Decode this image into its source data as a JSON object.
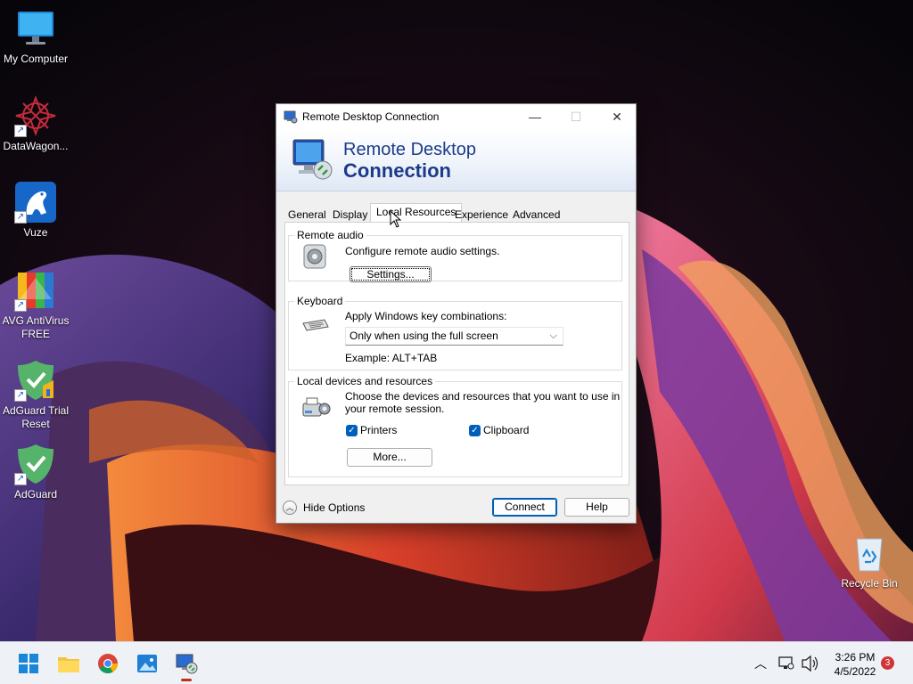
{
  "desktop": {
    "icons": [
      {
        "label": "My Computer",
        "icon": "monitor-icon"
      },
      {
        "label": "DataWagon...",
        "icon": "datawagon-icon"
      },
      {
        "label": "Vuze",
        "icon": "vuze-frog-icon"
      },
      {
        "label": "AVG AntiVirus FREE",
        "icon": "avg-icon"
      },
      {
        "label": "AdGuard Trial Reset",
        "icon": "adguard-trial-icon"
      },
      {
        "label": "AdGuard",
        "icon": "adguard-shield-icon"
      },
      {
        "label": "Recycle Bin",
        "icon": "recycle-bin-icon"
      }
    ]
  },
  "dialog": {
    "title": "Remote Desktop Connection",
    "banner": {
      "line1": "Remote Desktop",
      "line2": "Connection"
    },
    "tabs": [
      "General",
      "Display",
      "Local Resources",
      "Experience",
      "Advanced"
    ],
    "active_tab": "Local Resources",
    "remote_audio": {
      "label": "Remote audio",
      "description": "Configure remote audio settings.",
      "button": "Settings..."
    },
    "keyboard": {
      "label": "Keyboard",
      "description": "Apply Windows key combinations:",
      "selected": "Only when using the full screen",
      "example": "Example: ALT+TAB"
    },
    "local_devices": {
      "label": "Local devices and resources",
      "description_line1": "Choose the devices and resources that you want to use in",
      "description_line2": "your remote session.",
      "checkboxes": [
        {
          "label": "Printers",
          "checked": true
        },
        {
          "label": "Clipboard",
          "checked": true
        }
      ],
      "more_button": "More..."
    },
    "footer": {
      "hide_options": "Hide Options",
      "connect": "Connect",
      "help": "Help"
    }
  },
  "taskbar": {
    "apps": [
      "start-button",
      "file-explorer",
      "chrome",
      "photos",
      "remote-desktop"
    ],
    "clock_time": "3:26 PM",
    "clock_date": "4/5/2022",
    "notification_count": "3"
  }
}
